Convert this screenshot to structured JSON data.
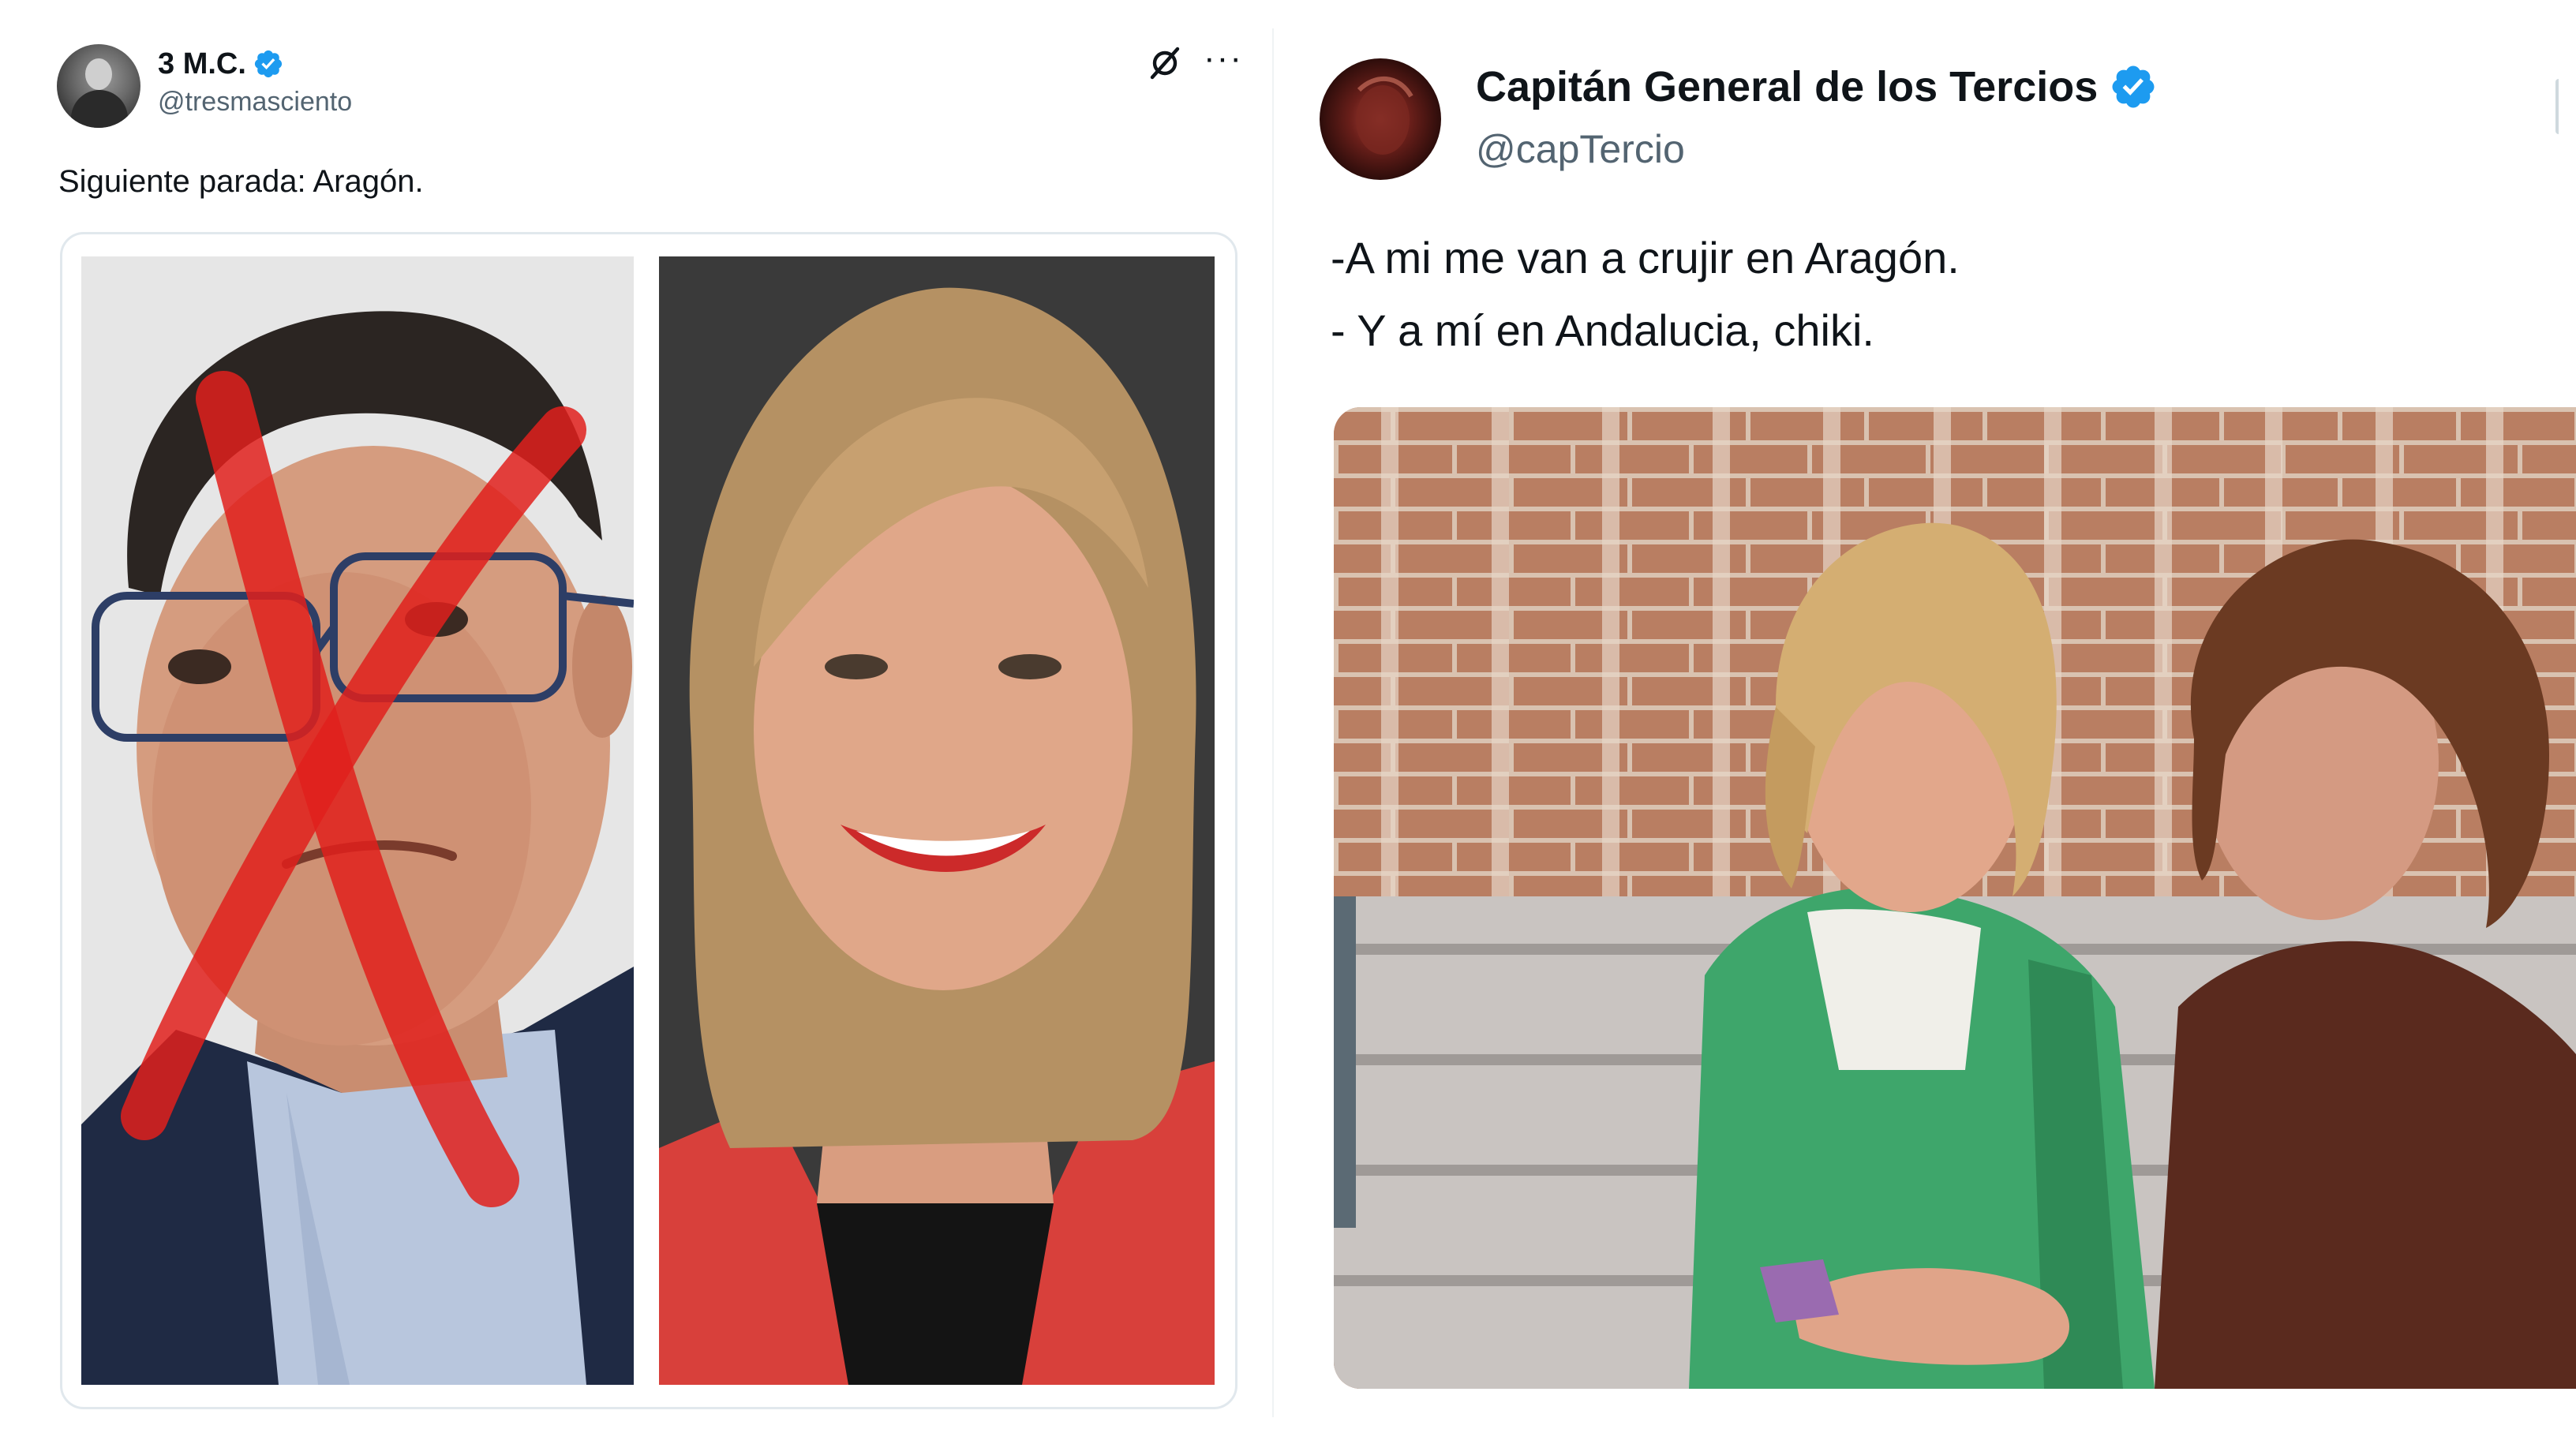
{
  "left_tweet": {
    "display_name": "3 M.C.",
    "handle": "@tresmasciento",
    "text": "Siguiente parada: Aragón.",
    "icons": [
      "grok-icon",
      "more-icon",
      "verified-badge-icon"
    ],
    "more_label": "···"
  },
  "right_tweet": {
    "display_name": "Capitán General de los Tercios",
    "handle": "@capTercio",
    "text_line_1": "-A mi me van a crujir en Aragón.",
    "text_line_2": "- Y a mí en Andalucia, chiki.",
    "icons": [
      "verified-badge-icon"
    ]
  },
  "colors": {
    "verified_blue": "#1d9bf0",
    "text_primary": "#0f1419",
    "text_secondary": "#536471",
    "border": "#e1e8ed",
    "red_cross": "#e0201c"
  }
}
